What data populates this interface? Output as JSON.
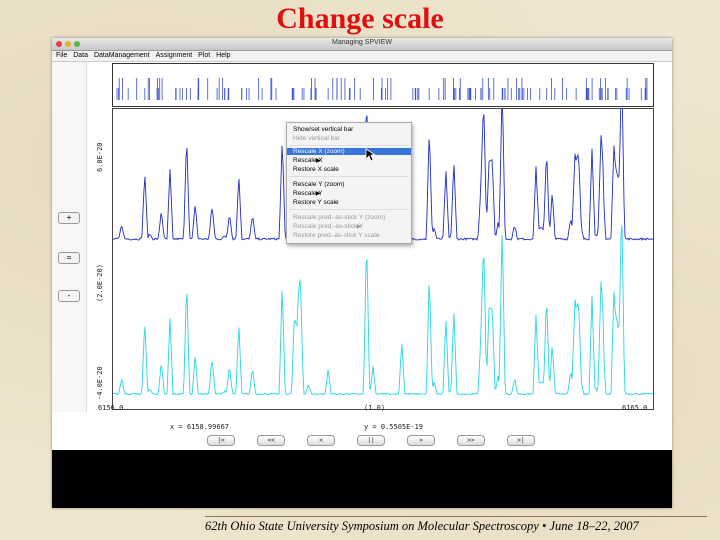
{
  "slide": {
    "title": "Change scale",
    "footer": "62th Ohio State University Symposium on Molecular Spectroscopy • June 18–22, 2007"
  },
  "window": {
    "title": "Managing SPVIEW",
    "traffic_colors": [
      "#e0443a",
      "#e8b22b",
      "#55b948"
    ]
  },
  "menubar": {
    "items": [
      "File",
      "Data",
      "DataManagement",
      "Assignment",
      "Plot",
      "Help"
    ]
  },
  "side_buttons": [
    "+",
    "=",
    "-"
  ],
  "axis": {
    "y_top": "6.0E-20",
    "y_mid": "(2.0E-20)",
    "y_bottom": "-4.0E-20",
    "x_min": "6156.0",
    "x_mid": "(1.0)",
    "x_max": "6165.0"
  },
  "status": {
    "x_readout": "x = 6158.99667",
    "y_readout": "y = 0.5505E-19"
  },
  "nav_buttons": [
    "|<",
    "<<",
    "<",
    "||",
    ">",
    ">>",
    ">|"
  ],
  "context_menu": {
    "items": [
      {
        "label": "Show/set vertical bar",
        "state": "normal",
        "submenu": false
      },
      {
        "label": "Hide vertical bar",
        "state": "disabled",
        "submenu": false
      },
      {
        "label": "Rescale X (zoom)",
        "state": "highlight",
        "submenu": false
      },
      {
        "label": "Rescale X",
        "state": "normal",
        "submenu": true
      },
      {
        "label": "Restore X scale",
        "state": "normal",
        "submenu": false
      },
      {
        "label": "Rescale Y (zoom)",
        "state": "normal",
        "submenu": false
      },
      {
        "label": "Rescale Y",
        "state": "normal",
        "submenu": true
      },
      {
        "label": "Restore Y scale",
        "state": "normal",
        "submenu": false
      },
      {
        "label": "Rescale pred.-as-stick Y (zoom)",
        "state": "disabled",
        "submenu": false
      },
      {
        "label": "Rescale pred.-as-stick Y",
        "state": "disabled",
        "submenu": true
      },
      {
        "label": "Restore pred.-as-stick Y scale",
        "state": "disabled",
        "submenu": false
      }
    ]
  },
  "colors": {
    "observed_trace": "#1f2fbf",
    "predicted_trace": "#28d6e6",
    "stick_lines": "#3a4fd0",
    "title": "#e01010",
    "menu_highlight": "#3875d7"
  }
}
